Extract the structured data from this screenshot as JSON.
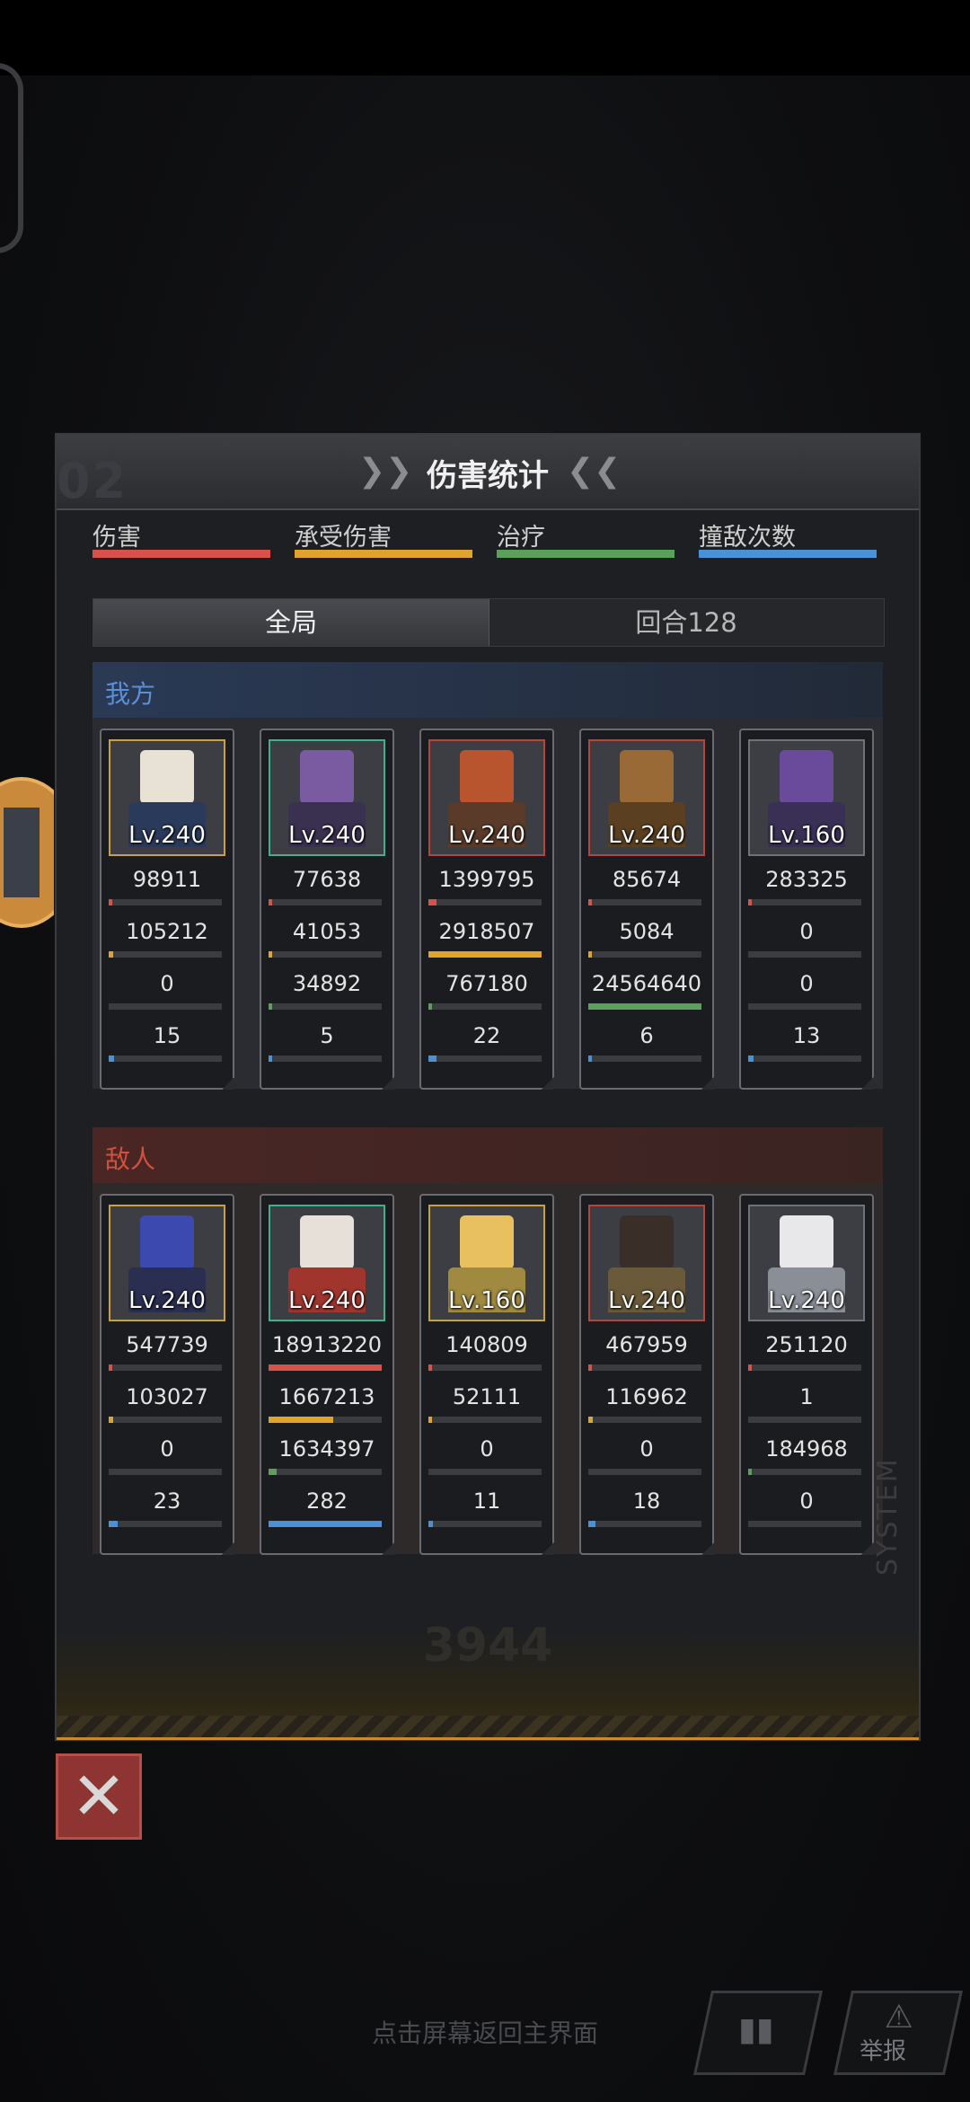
{
  "dialog": {
    "title": "伤害统计",
    "watermark_num": "02",
    "footer_num": "3944",
    "footer_vertical": "SYSTEM"
  },
  "legend": [
    {
      "label": "伤害",
      "color": "#d9524a"
    },
    {
      "label": "承受伤害",
      "color": "#e0a42c"
    },
    {
      "label": "治疗",
      "color": "#5aa05a"
    },
    {
      "label": "撞敌次数",
      "color": "#4a92d8"
    }
  ],
  "tabs": [
    {
      "label": "全局",
      "active": true
    },
    {
      "label": "回合128",
      "active": false
    }
  ],
  "allies": {
    "title": "我方",
    "title_color": "#5b8fd6",
    "members": [
      {
        "level": "Lv.240",
        "frame": "gold",
        "damage": "98911",
        "taken": "105212",
        "heal": "0",
        "hits": "15",
        "fills": [
          0.01,
          0.04,
          0.0,
          0.05
        ],
        "head": "#e8e2d6",
        "body": "#2a3a5a"
      },
      {
        "level": "Lv.240",
        "frame": "green",
        "damage": "77638",
        "taken": "41053",
        "heal": "34892",
        "hits": "5",
        "fills": [
          0.01,
          0.02,
          0.01,
          0.02
        ],
        "head": "#7a5aa0",
        "body": "#3a3050"
      },
      {
        "level": "Lv.240",
        "frame": "red",
        "damage": "1399795",
        "taken": "2918507",
        "heal": "767180",
        "hits": "22",
        "fills": [
          0.07,
          1.0,
          0.03,
          0.07
        ],
        "head": "#b8552e",
        "body": "#5a3a28"
      },
      {
        "level": "Lv.240",
        "frame": "red",
        "damage": "85674",
        "taken": "5084",
        "heal": "24564640",
        "hits": "6",
        "fills": [
          0.01,
          0.01,
          1.0,
          0.02
        ],
        "head": "#9a6a36",
        "body": "#5a4020"
      },
      {
        "level": "Lv.160",
        "frame": "gray",
        "damage": "283325",
        "taken": "0",
        "heal": "0",
        "hits": "13",
        "fills": [
          0.02,
          0.0,
          0.0,
          0.05
        ],
        "head": "#6a4a9a",
        "body": "#3a3056"
      }
    ]
  },
  "enemies": {
    "title": "敌人",
    "title_color": "#d0523e",
    "members": [
      {
        "level": "Lv.240",
        "frame": "gold",
        "damage": "547739",
        "taken": "103027",
        "heal": "0",
        "hits": "23",
        "fills": [
          0.03,
          0.04,
          0.0,
          0.08
        ],
        "head": "#3c4ab0",
        "body": "#2a2e50"
      },
      {
        "level": "Lv.240",
        "frame": "green",
        "damage": "18913220",
        "taken": "1667213",
        "heal": "1634397",
        "hits": "282",
        "fills": [
          1.0,
          0.57,
          0.07,
          1.0
        ],
        "head": "#e6e0d8",
        "body": "#a0352e"
      },
      {
        "level": "Lv.160",
        "frame": "gold",
        "damage": "140809",
        "taken": "52111",
        "heal": "0",
        "hits": "11",
        "fills": [
          0.01,
          0.02,
          0.0,
          0.04
        ],
        "head": "#e8c060",
        "body": "#a08a40"
      },
      {
        "level": "Lv.240",
        "frame": "red",
        "damage": "467959",
        "taken": "116962",
        "heal": "0",
        "hits": "18",
        "fills": [
          0.03,
          0.04,
          0.0,
          0.06
        ],
        "head": "#3a2e28",
        "body": "#6a5a3a"
      },
      {
        "level": "Lv.240",
        "frame": "gray",
        "damage": "251120",
        "taken": "1",
        "heal": "184968",
        "hits": "0",
        "fills": [
          0.01,
          0.0,
          0.01,
          0.0
        ],
        "head": "#e8e8ea",
        "body": "#8a8e96"
      }
    ]
  },
  "close_button": {
    "icon": "close-icon"
  },
  "hint": "点击屏幕返回主界面",
  "corner_buttons": [
    {
      "icon": "bar-chart-icon",
      "label": ""
    },
    {
      "icon": "warning-icon",
      "label": "举报"
    }
  ]
}
